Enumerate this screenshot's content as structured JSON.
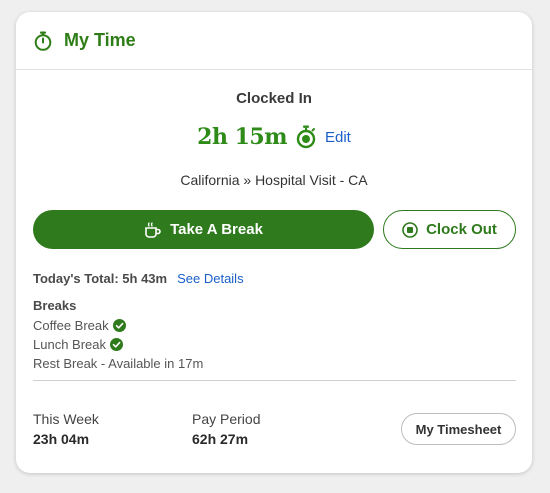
{
  "header": {
    "title": "My Time",
    "icon": "stopwatch-icon"
  },
  "status": {
    "label": "Clocked In",
    "elapsed": "2h 15m",
    "edit_label": "Edit",
    "location": "California » Hospital Visit - CA"
  },
  "actions": {
    "break_label": "Take A Break",
    "clockout_label": "Clock Out"
  },
  "today": {
    "total": "Today's Total: 5h 43m",
    "details_label": "See Details"
  },
  "breaks": {
    "title": "Breaks",
    "items": [
      {
        "label": "Coffee Break",
        "done": true
      },
      {
        "label": "Lunch Break",
        "done": true
      },
      {
        "label": "Rest Break - Available in 17m",
        "done": false
      }
    ]
  },
  "summary": {
    "week_label": "This Week",
    "week_value": "23h 04m",
    "period_label": "Pay Period",
    "period_value": "62h 27m",
    "timesheet_label": "My Timesheet"
  },
  "colors": {
    "brand_green": "#2e7a1c",
    "timer_green": "#2e8b17",
    "link_blue": "#1a5fc9"
  }
}
